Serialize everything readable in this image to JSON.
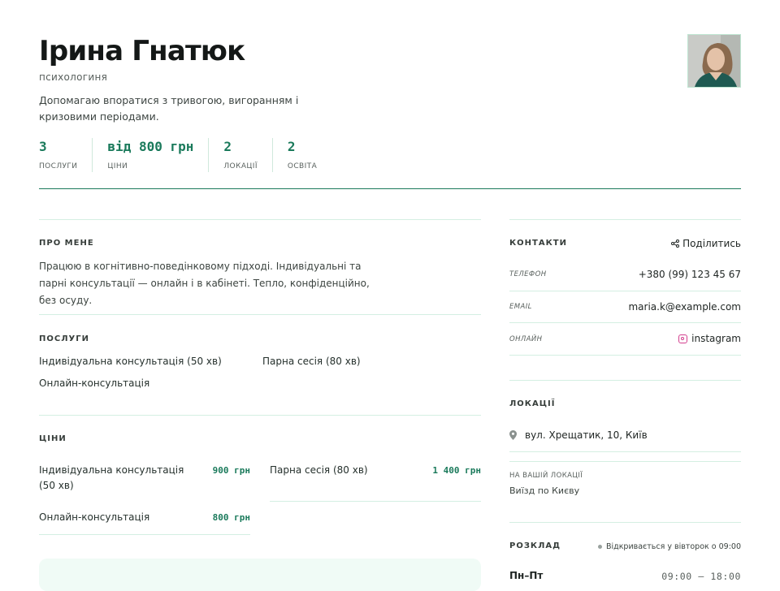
{
  "profile": {
    "name": "Ірина Гнатюк",
    "role": "психологиня",
    "bio": "Допомагаю впоратися з тривогою, вигоранням і кризовими періодами."
  },
  "stats": [
    {
      "value": "3",
      "label": "ПОСЛУГИ"
    },
    {
      "value": "від 800 грн",
      "label": "ЦІНИ"
    },
    {
      "value": "2",
      "label": "ЛОКАЦІЇ"
    },
    {
      "value": "2",
      "label": "ОСВІТА"
    }
  ],
  "about": {
    "title": "ПРО МЕНЕ",
    "text": "Працюю в когнітивно-поведінковому підході. Індивідуальні та парні консультації — онлайн і в кабінеті. Тепло, конфіденційно, без осуду."
  },
  "services": {
    "title": "ПОСЛУГИ",
    "items": [
      "Індивідуальна консультація (50 хв)",
      "Парна сесія (80 хв)",
      "Онлайн-консультація"
    ]
  },
  "prices": {
    "title": "ЦІНИ",
    "items": [
      {
        "name": "Індивідуальна консультація (50 хв)",
        "price": "900 грн"
      },
      {
        "name": "Парна сесія (80 хв)",
        "price": "1 400 грн"
      },
      {
        "name": "Онлайн-консультація",
        "price": "800 грн"
      }
    ]
  },
  "contacts": {
    "title": "КОНТАКТИ",
    "share_label": "Поділитись",
    "rows": [
      {
        "label": "ТЕЛЕФОН",
        "value": "+380 (99) 123 45 67"
      },
      {
        "label": "EMAIL",
        "value": "maria.k@example.com"
      },
      {
        "label": "ОНЛАЙН",
        "value": "instagram",
        "icon": "instagram-icon"
      }
    ]
  },
  "locations": {
    "title": "ЛОКАЦІЇ",
    "address": "вул. Хрещатик, 10, Київ",
    "client_location_label": "НА ВАШІЙ ЛОКАЦІЇ",
    "client_location_text": "Виїзд по Києву"
  },
  "schedule": {
    "title": "РОЗКЛАД",
    "status": "Відкривається у вівторок о 09:00",
    "rows": [
      {
        "day": "Пн–Пт",
        "hours": "09:00 — 18:00"
      }
    ]
  },
  "colors": {
    "accent": "#1a7a5b",
    "divider": "#d4efe2",
    "instagram": "#d33f8e"
  }
}
